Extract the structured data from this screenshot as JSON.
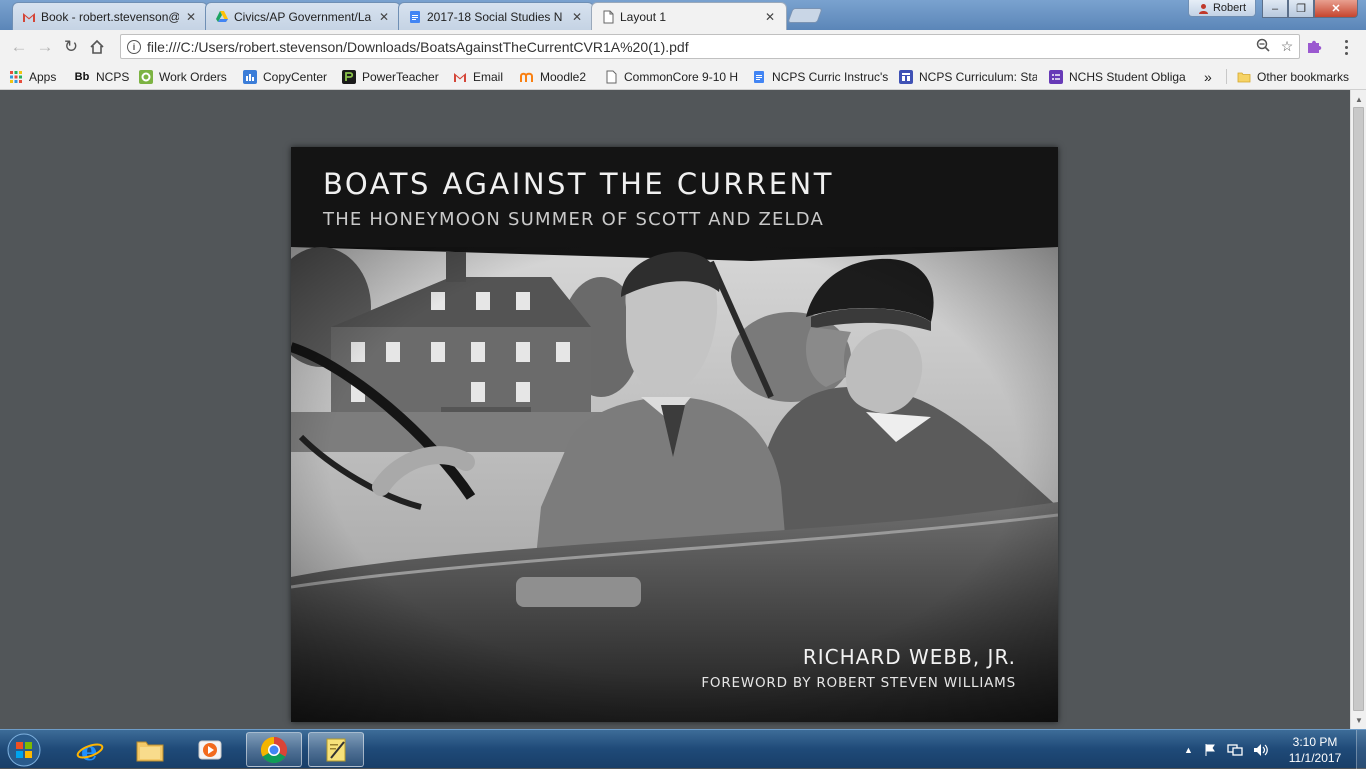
{
  "window": {
    "profile_name": "Robert",
    "controls": {
      "minimize": "–",
      "maximize": "❐",
      "close": "✕"
    }
  },
  "tabs": [
    {
      "label": "Book - robert.stevenson@",
      "icon": "gmail-icon",
      "active": false
    },
    {
      "label": "Civics/AP Government/La",
      "icon": "google-drive-icon",
      "active": false
    },
    {
      "label": "2017-18 Social Studies N",
      "icon": "google-docs-icon",
      "active": false
    },
    {
      "label": "Layout 1",
      "icon": "document-icon",
      "active": true
    }
  ],
  "toolbar": {
    "url": "file:///C:/Users/robert.stevenson/Downloads/BoatsAgainstTheCurrentCVR1A%20(1).pdf"
  },
  "bookmarks": [
    {
      "label": "Apps",
      "icon": "apps-grid-icon"
    },
    {
      "label": "NCPS",
      "icon": "blackboard-icon",
      "badge": "Bb"
    },
    {
      "label": "Work Orders",
      "icon": "work-orders-icon"
    },
    {
      "label": "CopyCenter",
      "icon": "copycenter-icon"
    },
    {
      "label": "PowerTeacher",
      "icon": "powerteacher-icon"
    },
    {
      "label": "Email",
      "icon": "gmail-icon"
    },
    {
      "label": "Moodle2",
      "icon": "moodle-icon"
    },
    {
      "label": "CommonCore 9-10 H",
      "icon": "page-icon"
    },
    {
      "label": "NCPS Curric Instruc's",
      "icon": "google-docs-icon"
    },
    {
      "label": "NCPS Curriculum: Sta",
      "icon": "curriculum-icon"
    },
    {
      "label": "NCHS Student Obliga",
      "icon": "forms-icon"
    }
  ],
  "bookmarks_overflow": "»",
  "other_bookmarks": "Other bookmarks",
  "pdf": {
    "title": "BOATS AGAINST THE CURRENT",
    "subtitle": "THE HONEYMOON SUMMER OF SCOTT AND ZELDA",
    "author": "RICHARD WEBB, JR.",
    "foreword": "FOREWORD BY ROBERT STEVEN WILLIAMS"
  },
  "taskbar": {
    "items": [
      {
        "name": "internet-explorer-icon",
        "active": false
      },
      {
        "name": "file-explorer-icon",
        "active": false
      },
      {
        "name": "media-player-icon",
        "active": false
      },
      {
        "name": "chrome-icon",
        "active": true
      },
      {
        "name": "notepad-icon",
        "active": true
      }
    ],
    "clock_time": "3:10 PM",
    "clock_date": "11/1/2017"
  },
  "colors": {
    "chrome_frame": "#5b86b8",
    "toolbar_bg": "#f2f2f2",
    "pdf_viewer_bg": "#525659",
    "cover_bg": "#141414",
    "taskbar": "#1f4a78"
  }
}
